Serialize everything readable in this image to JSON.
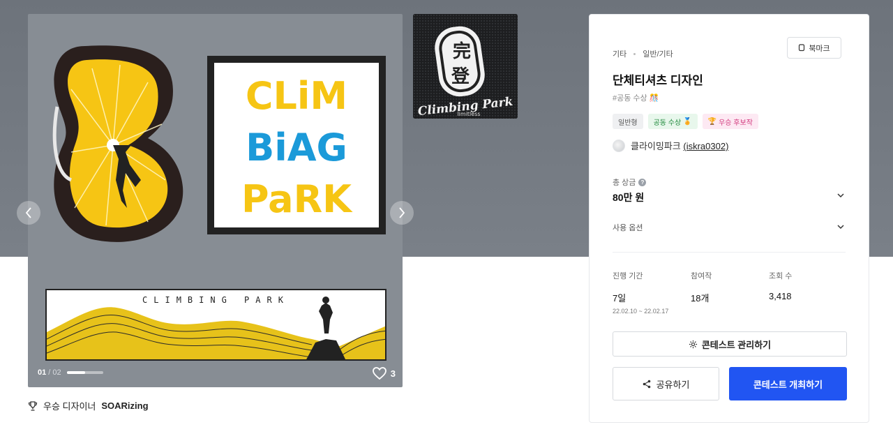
{
  "gallery": {
    "current": "01",
    "separator": " / ",
    "total": "02",
    "progress": 0.5,
    "likes": "3",
    "framed_text": [
      "CLiM",
      "BiAG",
      "PaRK"
    ],
    "banner_text": "CLIMBING PARK"
  },
  "thumbnail": {
    "kanji": [
      "完",
      "登"
    ],
    "brand": "Climbing Park",
    "sub": "limitless"
  },
  "winner": {
    "label": "우승 디자이너",
    "name": "SOARizing"
  },
  "panel": {
    "breadcrumb": [
      "기타",
      "일반/기타"
    ],
    "bookmark_label": "북마크",
    "title": "단체티셔츠 디자인",
    "tagline": "#공동 수상 🎊",
    "badges": {
      "type": "일반형",
      "co_winner": "공동 수상",
      "candidate": "우승 후보작"
    },
    "host": {
      "name": "클라이밍파크",
      "handle": "(iskra0302)"
    },
    "prize": {
      "label": "총 상금",
      "value": "80만 원"
    },
    "usage_label": "사용 옵션",
    "stats": {
      "period_label": "진행 기간",
      "period_value": "7일",
      "period_range": "22.02.10 ~ 22.02.17",
      "entries_label": "참여작",
      "entries_value": "18개",
      "views_label": "조회 수",
      "views_value": "3,418"
    },
    "manage_label": "콘테스트 관리하기",
    "share_label": "공유하기",
    "host_label": "콘테스트 개최하기"
  },
  "colors": {
    "accent": "#2155f2",
    "hero_bg": "#6d737b",
    "logo_yellow": "#f6c514",
    "logo_blue": "#1b9ad9"
  }
}
